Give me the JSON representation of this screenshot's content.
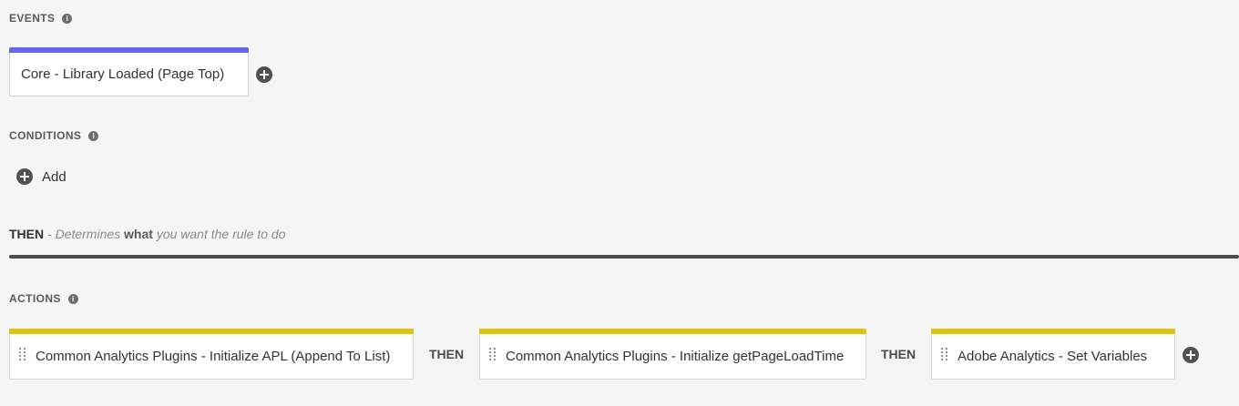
{
  "events": {
    "heading": "EVENTS",
    "info_glyph": "i",
    "items": [
      {
        "label": "Core - Library Loaded (Page Top)"
      }
    ]
  },
  "conditions": {
    "heading": "CONDITIONS",
    "info_glyph": "i",
    "add_label": "Add"
  },
  "then_section": {
    "then_word": "THEN",
    "description_prefix": " - Determines ",
    "description_emphasis": "what",
    "description_suffix": " you want the rule to do"
  },
  "actions": {
    "heading": "ACTIONS",
    "info_glyph": "i",
    "connector_label": "THEN",
    "items": [
      {
        "label": "Common Analytics Plugins - Initialize APL (Append To List)"
      },
      {
        "label": "Common Analytics Plugins - Initialize getPageLoadTime"
      },
      {
        "label": "Adobe Analytics - Set Variables"
      }
    ]
  },
  "colors": {
    "event_accent": "#6767ec",
    "action_accent": "#e0c210",
    "background": "#f5f5f5"
  },
  "icons": {
    "info": "info-icon",
    "add": "plus-circle-icon",
    "drag": "drag-handle-icon"
  }
}
